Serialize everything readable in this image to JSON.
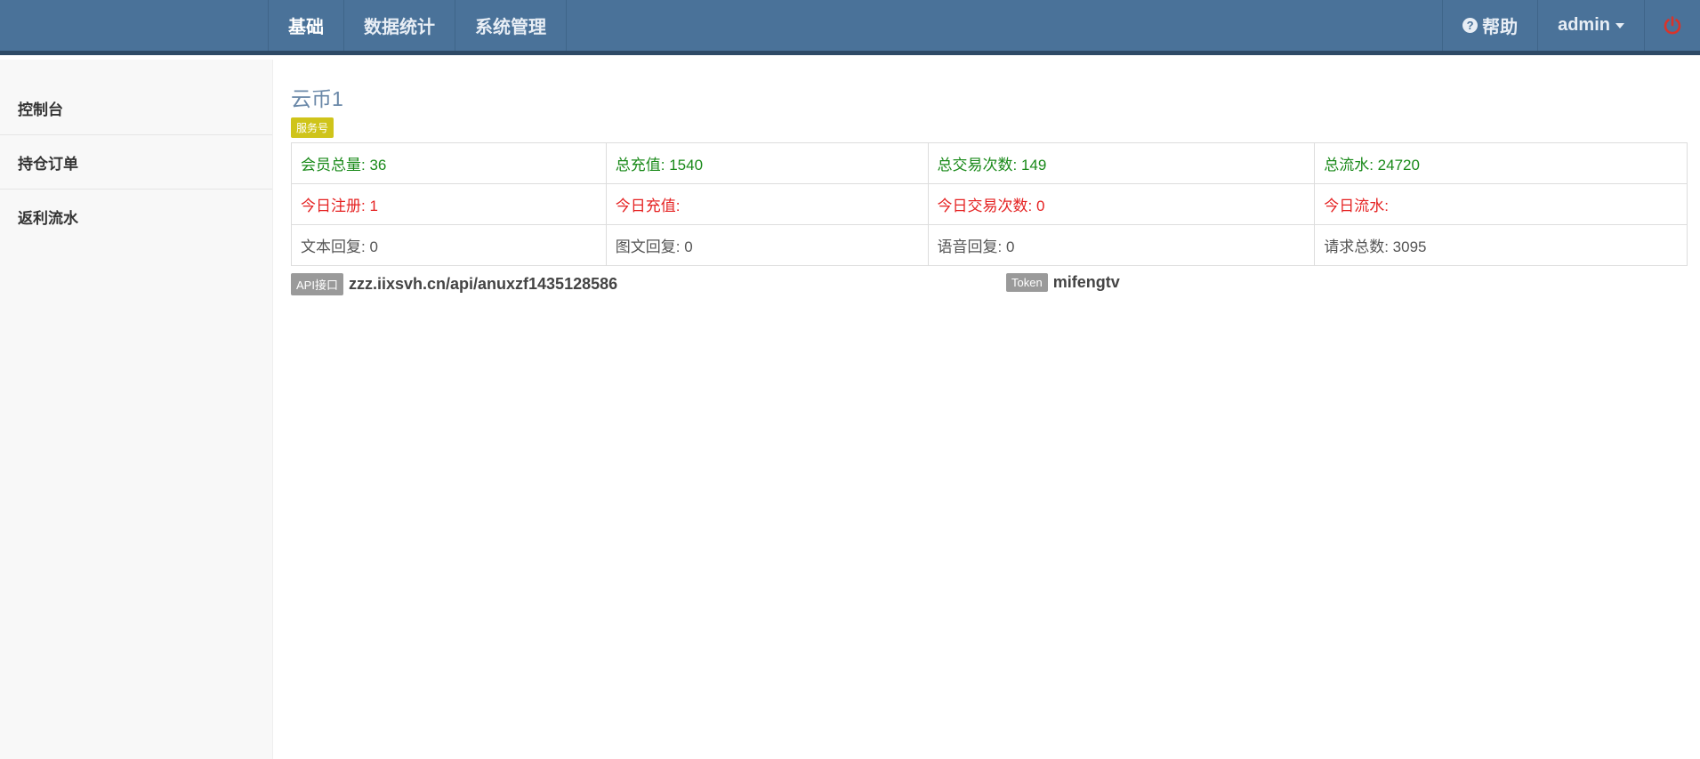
{
  "navbar": {
    "tabs": [
      {
        "label": "基础"
      },
      {
        "label": "数据统计"
      },
      {
        "label": "系统管理"
      }
    ],
    "help_label": "帮助",
    "help_icon": "question-circle-icon",
    "user_label": "admin",
    "power_icon": "power-icon",
    "colors": {
      "bar": "#4a7299",
      "power": "#d9342b"
    }
  },
  "sidebar": {
    "items": [
      {
        "label": "控制台"
      },
      {
        "label": "持仓订单"
      },
      {
        "label": "返利流水"
      }
    ]
  },
  "main": {
    "title": "云币1",
    "badge": "服务号",
    "stats": {
      "row1": [
        "会员总量: 36",
        "总充值: 1540",
        "总交易次数: 149",
        "总流水: 24720"
      ],
      "row2": [
        "今日注册: 1",
        "今日充值:",
        "今日交易次数: 0",
        "今日流水:"
      ],
      "row3": [
        "文本回复: 0",
        "图文回复: 0",
        "语音回复: 0",
        "请求总数: 3095"
      ]
    },
    "api": {
      "badge": "API接口",
      "value": "zzz.iixsvh.cn/api/anuxzf1435128586"
    },
    "token": {
      "badge": "Token",
      "value": "mifengtv"
    }
  }
}
